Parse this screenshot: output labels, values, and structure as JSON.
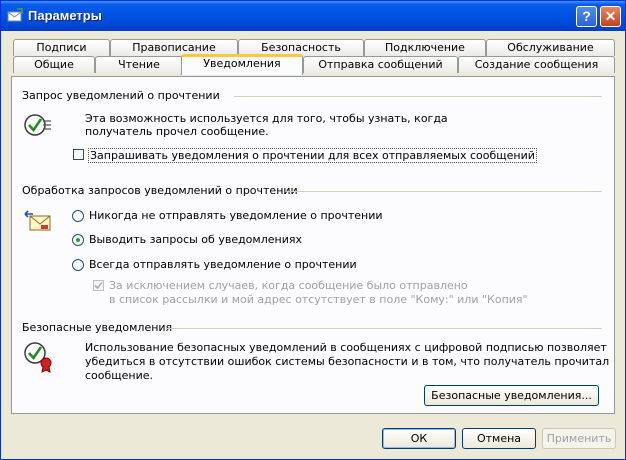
{
  "window": {
    "title": "Параметры"
  },
  "tabs_row1": [
    "Подписи",
    "Правописание",
    "Безопасность",
    "Подключение",
    "Обслуживание"
  ],
  "tabs_row2": [
    "Общие",
    "Чтение",
    "Уведомления",
    "Отправка сообщений",
    "Создание сообщения"
  ],
  "read_receipts": {
    "title": "Запрос уведомлений о прочтении",
    "description": "Эта возможность используется для того, чтобы узнать, когда получатель прочел сообщение.",
    "request_all_label": "Запрашивать уведомления о прочтении для всех отправляемых сообщений"
  },
  "returning": {
    "title": "Обработка запросов уведомлений о прочтении",
    "never_label": "Никогда не отправлять уведомление о прочтении",
    "notify_label": "Выводить запросы об уведомлениях",
    "always_label": "Всегда отправлять уведомление о прочтении",
    "except_line1": "За исключением случаев, когда сообщение было отправлено",
    "except_line2": "в список рассылки и мой адрес отсутствует в поле \"Кому:\" или \"Копия\""
  },
  "secure": {
    "title": "Безопасные уведомления",
    "line1": "Использование безопасных уведомлений в сообщениях с цифровой подписью позволяет",
    "line2": "убедиться в отсутствии ошибок системы безопасности и в том, что получатель прочитал",
    "line3": "сообщение.",
    "button_label": "Безопасные уведомления..."
  },
  "footer": {
    "ok": "ОК",
    "cancel": "Отмена",
    "apply": "Применить"
  },
  "colors": {
    "title_bar": "#0054e3",
    "active_tab_accent": "#ffc83c",
    "dialog_bg": "#ece9d8"
  }
}
